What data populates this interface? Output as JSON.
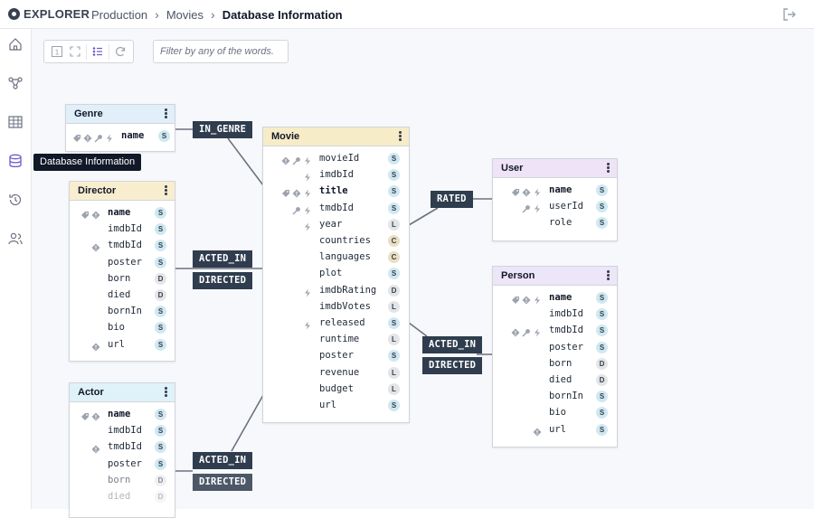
{
  "app": {
    "name": "EXPLORER"
  },
  "breadcrumb": [
    "Production",
    "Movies",
    "Database Information"
  ],
  "filter": {
    "placeholder": "Filter by any of the words."
  },
  "tooltip": "Database Information",
  "colors": {
    "genre": "#e1effb",
    "director": "#f8eecf",
    "movie": "#f7ecc8",
    "user": "#efe3f8",
    "person": "#ede5f8",
    "actor": "#e0f2f9",
    "relationship": "#2f3d4e"
  },
  "sidebar_icons": [
    "home-icon",
    "graph-icon",
    "table-icon",
    "database-icon",
    "history-icon",
    "users-icon"
  ],
  "toolbar_icons": [
    "single-view-icon",
    "fit-screen-icon",
    "list-view-icon",
    "refresh-icon"
  ],
  "nodes": {
    "genre": {
      "title": "Genre",
      "props": [
        {
          "name": "name",
          "type": "S",
          "icons": [
            "tag-icon",
            "constraint-icon",
            "key-icon",
            "bolt-icon"
          ],
          "bold": true
        }
      ]
    },
    "director": {
      "title": "Director",
      "props": [
        {
          "name": "name",
          "type": "S",
          "icons": [
            "tag-icon",
            "constraint-icon"
          ],
          "bold": true
        },
        {
          "name": "imdbId",
          "type": "S",
          "icons": []
        },
        {
          "name": "tmdbId",
          "type": "S",
          "icons": [
            "constraint-icon"
          ]
        },
        {
          "name": "poster",
          "type": "S",
          "icons": []
        },
        {
          "name": "born",
          "type": "D",
          "icons": []
        },
        {
          "name": "died",
          "type": "D",
          "icons": []
        },
        {
          "name": "bornIn",
          "type": "S",
          "icons": []
        },
        {
          "name": "bio",
          "type": "S",
          "icons": []
        },
        {
          "name": "url",
          "type": "S",
          "icons": [
            "constraint-icon"
          ]
        }
      ]
    },
    "actor": {
      "title": "Actor",
      "props": [
        {
          "name": "name",
          "type": "S",
          "icons": [
            "tag-icon",
            "constraint-icon"
          ],
          "bold": true
        },
        {
          "name": "imdbId",
          "type": "S",
          "icons": []
        },
        {
          "name": "tmdbId",
          "type": "S",
          "icons": [
            "constraint-icon"
          ]
        },
        {
          "name": "poster",
          "type": "S",
          "icons": []
        },
        {
          "name": "born",
          "type": "D",
          "icons": []
        },
        {
          "name": "died",
          "type": "D",
          "icons": []
        }
      ]
    },
    "movie": {
      "title": "Movie",
      "props": [
        {
          "name": "movieId",
          "type": "S",
          "icons": [
            "constraint-icon",
            "key-icon",
            "bolt-icon"
          ]
        },
        {
          "name": "imdbId",
          "type": "S",
          "icons": [
            "bolt-icon"
          ]
        },
        {
          "name": "title",
          "type": "S",
          "icons": [
            "tag-icon",
            "constraint-icon",
            "bolt-icon"
          ],
          "bold": true
        },
        {
          "name": "tmdbId",
          "type": "S",
          "icons": [
            "key-icon",
            "bolt-icon"
          ]
        },
        {
          "name": "year",
          "type": "L",
          "icons": [
            "bolt-icon"
          ]
        },
        {
          "name": "countries",
          "type": "C",
          "icons": []
        },
        {
          "name": "languages",
          "type": "C",
          "icons": []
        },
        {
          "name": "plot",
          "type": "S",
          "icons": []
        },
        {
          "name": "imdbRating",
          "type": "D",
          "icons": [
            "bolt-icon"
          ]
        },
        {
          "name": "imdbVotes",
          "type": "L",
          "icons": []
        },
        {
          "name": "released",
          "type": "S",
          "icons": [
            "bolt-icon"
          ]
        },
        {
          "name": "runtime",
          "type": "L",
          "icons": []
        },
        {
          "name": "poster",
          "type": "S",
          "icons": []
        },
        {
          "name": "revenue",
          "type": "L",
          "icons": []
        },
        {
          "name": "budget",
          "type": "L",
          "icons": []
        },
        {
          "name": "url",
          "type": "S",
          "icons": []
        }
      ]
    },
    "user": {
      "title": "User",
      "props": [
        {
          "name": "name",
          "type": "S",
          "icons": [
            "tag-icon",
            "constraint-icon",
            "bolt-icon"
          ],
          "bold": true
        },
        {
          "name": "userId",
          "type": "S",
          "icons": [
            "key-icon",
            "bolt-icon"
          ]
        },
        {
          "name": "role",
          "type": "S",
          "icons": []
        }
      ]
    },
    "person": {
      "title": "Person",
      "props": [
        {
          "name": "name",
          "type": "S",
          "icons": [
            "tag-icon",
            "constraint-icon",
            "bolt-icon"
          ],
          "bold": true
        },
        {
          "name": "imdbId",
          "type": "S",
          "icons": []
        },
        {
          "name": "tmdbId",
          "type": "S",
          "icons": [
            "constraint-icon",
            "key-icon",
            "bolt-icon"
          ]
        },
        {
          "name": "poster",
          "type": "S",
          "icons": []
        },
        {
          "name": "born",
          "type": "D",
          "icons": []
        },
        {
          "name": "died",
          "type": "D",
          "icons": []
        },
        {
          "name": "bornIn",
          "type": "S",
          "icons": []
        },
        {
          "name": "bio",
          "type": "S",
          "icons": []
        },
        {
          "name": "url",
          "type": "S",
          "icons": [
            "constraint-icon"
          ]
        }
      ]
    }
  },
  "relationships": {
    "in_genre": "IN_GENRE",
    "rated": "RATED",
    "acted_in_1": "ACTED_IN",
    "directed_1": "DIRECTED",
    "acted_in_2": "ACTED_IN",
    "directed_2": "DIRECTED",
    "acted_in_3": "ACTED_IN",
    "directed_3": "DIRECTED"
  }
}
